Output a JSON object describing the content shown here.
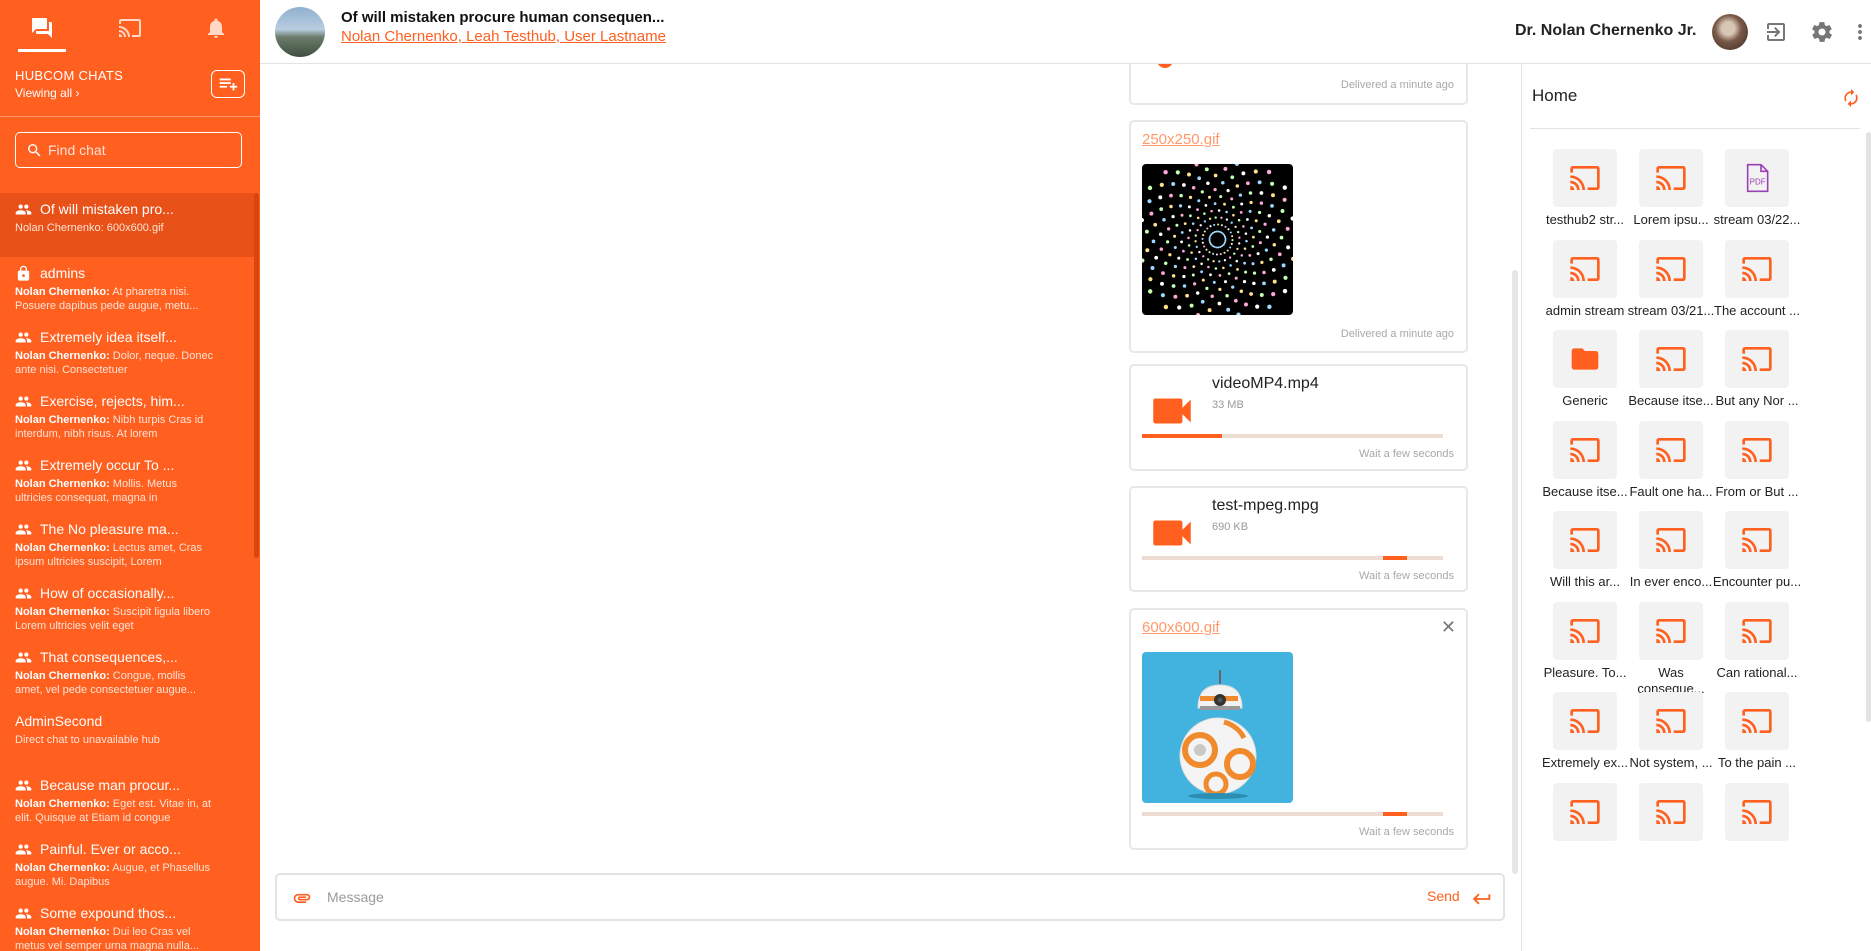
{
  "sidebar": {
    "title": "HUBCOM CHATS",
    "subtitle": "Viewing all",
    "search_placeholder": "Find chat",
    "accent": "#ff5f1f",
    "top_icons": [
      "chat-icon",
      "cast-icon",
      "bell-icon"
    ],
    "chats": [
      {
        "name": "Of will mistaken pro...",
        "sender": "",
        "preview": "Nolan Chernenko: 600x600.gif",
        "icon": "group-icon",
        "active": true
      },
      {
        "name": "admins",
        "sender": "Nolan Chernenko:",
        "preview": "At pharetra nisi. Posuere dapibus pede augue, metu...",
        "icon": "lock-icon"
      },
      {
        "name": "Extremely idea itself...",
        "sender": "Nolan Chernenko:",
        "preview": "Dolor, neque. Donec ante nisi. Consectetuer",
        "icon": "group-icon"
      },
      {
        "name": "Exercise, rejects, him...",
        "sender": "Nolan Chernenko:",
        "preview": "Nibh turpis Cras id interdum, nibh risus. At lorem",
        "icon": "group-icon"
      },
      {
        "name": "Extremely occur To ...",
        "sender": "Nolan Chernenko:",
        "preview": "Mollis. Metus ultricies consequat, magna in",
        "icon": "group-icon"
      },
      {
        "name": "The No pleasure ma...",
        "sender": "Nolan Chernenko:",
        "preview": "Lectus amet, Cras ipsum ultricies suscipit, Lorem",
        "icon": "group-icon"
      },
      {
        "name": "How of occasionally...",
        "sender": "Nolan Chernenko:",
        "preview": "Suscipit ligula libero Lorem ultricies velit eget",
        "icon": "group-icon"
      },
      {
        "name": "That consequences,...",
        "sender": "Nolan Chernenko:",
        "preview": "Congue, mollis amet, vel pede consectetuer augue...",
        "icon": "group-icon"
      },
      {
        "name": "AdminSecond",
        "sender": "",
        "preview": "Direct chat to unavailable hub",
        "icon": ""
      },
      {
        "name": "Because man procur...",
        "sender": "Nolan Chernenko:",
        "preview": "Eget est. Vitae in, at elit. Quisque at Etiam id congue",
        "icon": "group-icon"
      },
      {
        "name": "Painful. Ever or acco...",
        "sender": "Nolan Chernenko:",
        "preview": "Augue, et Phasellus augue. Mi. Dapibus",
        "icon": "group-icon"
      },
      {
        "name": "Some expound thos...",
        "sender": "Nolan Chernenko:",
        "preview": "Dui leo Cras vel metus vel semper urna magna nulla...",
        "icon": "group-icon"
      }
    ]
  },
  "header": {
    "chat_title": "Of will mistaken procure human consequen...",
    "members": "Nolan Chernenko, Leah Testhub, User Lastname",
    "username": "Dr. Nolan Chernenko Jr.",
    "icons": [
      "logout-icon",
      "gear-icon",
      "more-vert-icon"
    ]
  },
  "messages": [
    {
      "kind": "partial",
      "status": "Delivered a minute ago"
    },
    {
      "kind": "gif",
      "file": "250x250.gif",
      "status": "Delivered a minute ago"
    },
    {
      "kind": "video",
      "file": "videoMP4.mp4",
      "size": "33 MB",
      "status": "Wait a few seconds",
      "progress": 0.22
    },
    {
      "kind": "video",
      "file": "test-mpeg.mpg",
      "size": "690 KB",
      "status": "Wait a few seconds",
      "progress_start": 0.68,
      "progress": 0.07
    },
    {
      "kind": "gif",
      "file": "600x600.gif",
      "status": "Wait a few seconds",
      "progress_start": 0.68,
      "progress": 0.07,
      "closable": true
    }
  ],
  "composer": {
    "placeholder": "Message",
    "send_label": "Send"
  },
  "right_panel": {
    "title": "Home",
    "items": [
      {
        "label": "testhub2 str...",
        "icon": "cast-icon"
      },
      {
        "label": "Lorem ipsu...",
        "icon": "cast-icon"
      },
      {
        "label": "stream 03/22...",
        "icon": "pdf-icon"
      },
      {
        "label": "admin stream",
        "icon": "cast-icon"
      },
      {
        "label": "stream 03/21...",
        "icon": "cast-icon"
      },
      {
        "label": "The account ...",
        "icon": "cast-icon"
      },
      {
        "label": "Generic",
        "icon": "folder-icon"
      },
      {
        "label": "Because itse...",
        "icon": "cast-icon"
      },
      {
        "label": "But any Nor ...",
        "icon": "cast-icon"
      },
      {
        "label": "Because itse...",
        "icon": "cast-icon"
      },
      {
        "label": "Fault one ha...",
        "icon": "cast-icon"
      },
      {
        "label": "From or But ...",
        "icon": "cast-icon"
      },
      {
        "label": "Will this ar...",
        "icon": "cast-icon"
      },
      {
        "label": "In ever enco...",
        "icon": "cast-icon"
      },
      {
        "label": "Encounter pu...",
        "icon": "cast-icon"
      },
      {
        "label": "Pleasure. To...",
        "icon": "cast-icon"
      },
      {
        "label": "Was conseque...",
        "icon": "cast-icon"
      },
      {
        "label": "Can rational...",
        "icon": "cast-icon"
      },
      {
        "label": "Extremely ex...",
        "icon": "cast-icon"
      },
      {
        "label": "Not system, ...",
        "icon": "cast-icon"
      },
      {
        "label": "To the pain ...",
        "icon": "cast-icon"
      },
      {
        "label": "",
        "icon": "cast-icon"
      },
      {
        "label": "",
        "icon": "cast-icon"
      },
      {
        "label": "",
        "icon": "cast-icon"
      }
    ]
  }
}
